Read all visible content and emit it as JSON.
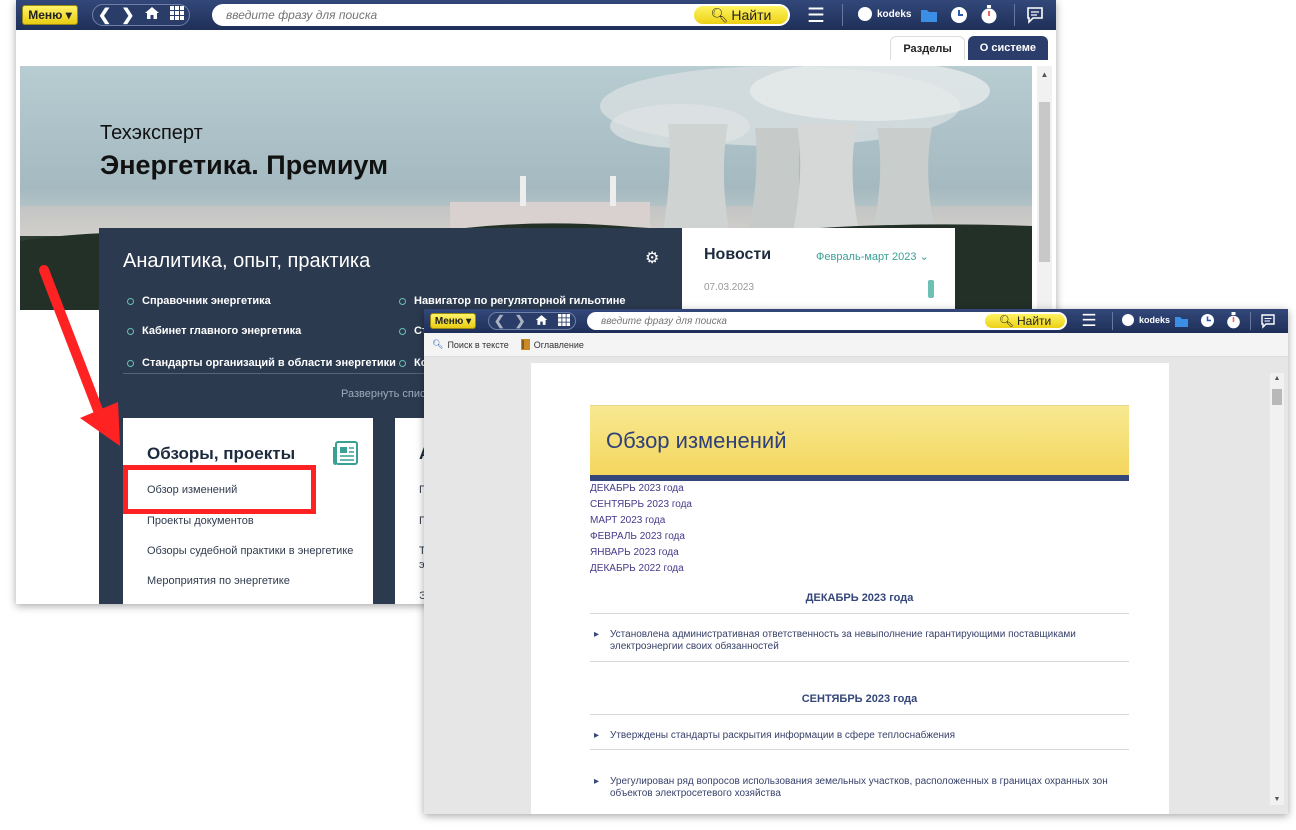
{
  "main_window": {
    "toolbar": {
      "menu_label": "Меню ▾",
      "search_placeholder": "введите фразу для поиска",
      "find_label": "Найти",
      "user_name": "kodeks"
    },
    "tabs": [
      {
        "label": "Разделы"
      },
      {
        "label": "О системе"
      }
    ],
    "banner": {
      "title_small": "Техэксперт",
      "title_big": "Энергетика. Премиум"
    },
    "panel": {
      "title": "Аналитика, опыт, практика",
      "links": [
        {
          "label": "Справочник энергетика"
        },
        {
          "label": "Кабинет главного энергетика"
        },
        {
          "label": "Стандарты организаций в области энергетики"
        },
        {
          "label": "Навигатор по регуляторной гильотине"
        },
        {
          "label": "Ст"
        },
        {
          "label": "Ко"
        }
      ],
      "expand_label": "Развернуть спис"
    },
    "news": {
      "title": "Новости",
      "period": "Февраль-март 2023",
      "date": "07.03.2023"
    },
    "cards": [
      {
        "title": "Обзоры, проекты",
        "links": [
          "Обзор изменений",
          "Проекты документов",
          "Обзоры судебной практики в энергетике",
          "Мероприятия по энергетике"
        ]
      },
      {
        "title": "А",
        "links": [
          "П",
          "Г",
          "Те",
          "э",
          "Э"
        ]
      }
    ]
  },
  "doc_window": {
    "toolbar": {
      "menu_label": "Меню ▾",
      "search_placeholder": "введите фразу для поиска",
      "find_label": "Найти",
      "user_name": "kodeks"
    },
    "subtoolbar": {
      "search_in_text": "Поиск в тексте",
      "contents": "Оглавление"
    },
    "document": {
      "header": "Обзор изменений",
      "toc": [
        "ДЕКАБРЬ 2023 года",
        "СЕНТЯБРЬ 2023 года",
        "МАРТ 2023 года",
        "ФЕВРАЛЬ 2023 года",
        "ЯНВАРЬ 2023 года",
        "ДЕКАБРЬ 2022 года"
      ],
      "sections": [
        {
          "title": "ДЕКАБРЬ 2023 года",
          "items": [
            "Установлена административная ответственность за невыполнение гарантирующими поставщиками электроэнергии своих обязанностей"
          ]
        },
        {
          "title": "СЕНТЯБРЬ 2023 года",
          "items": [
            "Утверждены стандарты раскрытия информации в сфере теплоснабжения",
            "Урегулирован ряд вопросов использования земельных участков, расположенных в границах охранных зон объектов электросетевого хозяйства"
          ]
        }
      ]
    }
  },
  "colors": {
    "toolbar": "#24365f",
    "accent_yellow": "#f5dd2a",
    "panel": "#2c3a4f",
    "highlight_red": "#ff2222",
    "teal": "#3aa096"
  }
}
